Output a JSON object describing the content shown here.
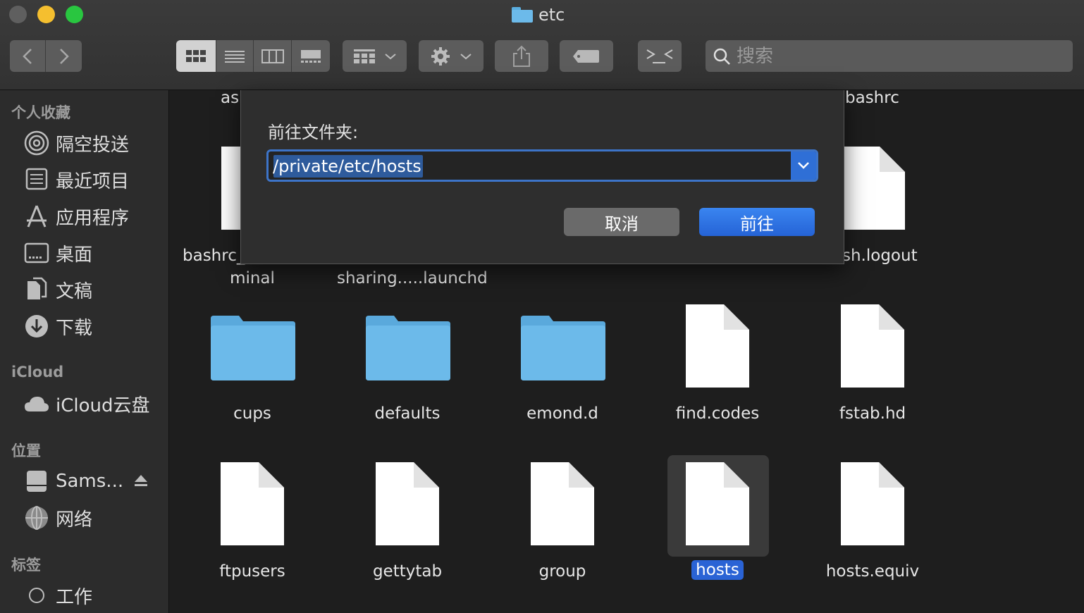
{
  "window": {
    "title": "etc"
  },
  "colors": {
    "accent": "#2a63d5",
    "folder": "#6cbaea",
    "close_light": "#5f5f5f",
    "min_light": "#f5bf2f",
    "max_light": "#29c640"
  },
  "toolbar": {
    "back_icon": "chevron-left-icon",
    "forward_icon": "chevron-right-icon",
    "view_modes": [
      "icon-view",
      "list-view",
      "column-view",
      "gallery-view"
    ],
    "active_view": "icon-view",
    "group_icon": "group-by-icon",
    "action_icon": "gear-icon",
    "share_icon": "share-icon",
    "tag_icon": "tag-icon",
    "terminal_icon": "terminal-icon",
    "search_placeholder": "搜索"
  },
  "sidebar": {
    "sections": [
      {
        "header": "个人收藏",
        "items": [
          {
            "label": "隔空投送",
            "icon": "airdrop-icon"
          },
          {
            "label": "最近项目",
            "icon": "recents-icon"
          },
          {
            "label": "应用程序",
            "icon": "applications-icon"
          },
          {
            "label": "桌面",
            "icon": "desktop-icon"
          },
          {
            "label": "文稿",
            "icon": "documents-icon"
          },
          {
            "label": "下载",
            "icon": "downloads-icon"
          }
        ]
      },
      {
        "header": "iCloud",
        "items": [
          {
            "label": "iCloud云盘",
            "icon": "cloud-icon"
          }
        ]
      },
      {
        "header": "位置",
        "items": [
          {
            "label": "Sams...",
            "icon": "disk-icon"
          },
          {
            "label": "网络",
            "icon": "network-icon"
          }
        ]
      },
      {
        "header": "标签",
        "items": [
          {
            "label": "工作",
            "icon": "tag-circle-icon"
          }
        ]
      }
    ]
  },
  "files": {
    "partial_top": [
      "as",
      "bashrc"
    ],
    "row1": [
      "bashrc_",
      "sh.logout"
    ],
    "row1_second_line": [
      "minal",
      "sharing.....launchd"
    ],
    "row2": [
      {
        "name": "cups",
        "kind": "folder"
      },
      {
        "name": "defaults",
        "kind": "folder"
      },
      {
        "name": "emond.d",
        "kind": "folder"
      },
      {
        "name": "find.codes",
        "kind": "file"
      },
      {
        "name": "fstab.hd",
        "kind": "file"
      }
    ],
    "row3": [
      {
        "name": "ftpusers",
        "kind": "file"
      },
      {
        "name": "gettytab",
        "kind": "file"
      },
      {
        "name": "group",
        "kind": "file"
      },
      {
        "name": "hosts",
        "kind": "file",
        "selected": true
      },
      {
        "name": "hosts.equiv",
        "kind": "file"
      }
    ]
  },
  "dialog": {
    "prompt": "前往文件夹:",
    "path_value": "/private/etc/hosts",
    "cancel_label": "取消",
    "go_label": "前往"
  }
}
